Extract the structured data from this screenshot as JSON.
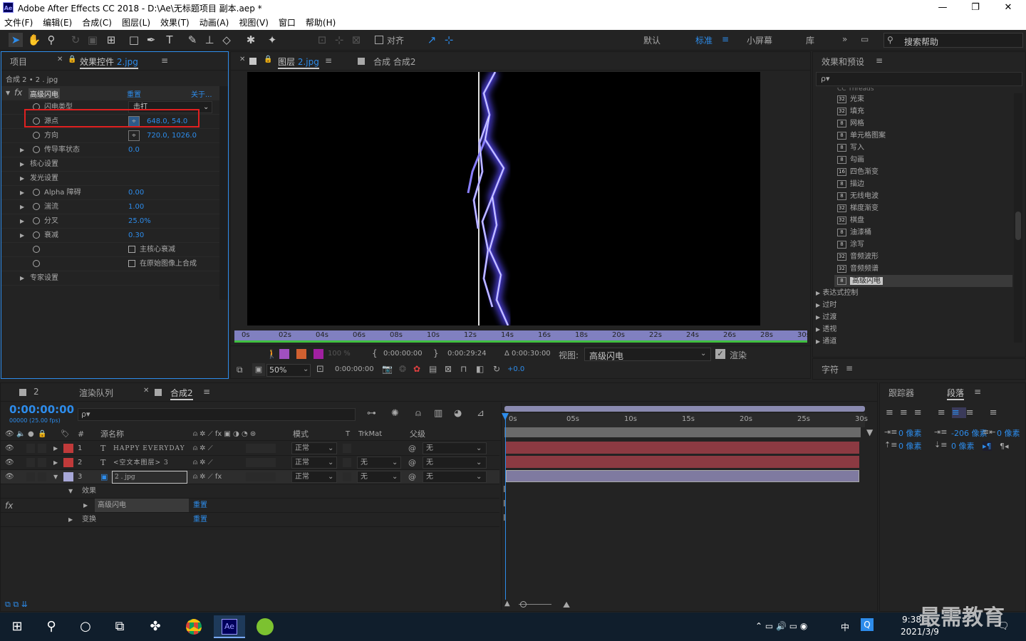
{
  "title_bar": {
    "app_icon": "Ae",
    "title": "Adobe After Effects CC 2018 - D:\\Ae\\无标题项目 副本.aep *",
    "minimize": "—",
    "maximize": "❐",
    "close": "✕"
  },
  "menu": [
    "文件(F)",
    "编辑(E)",
    "合成(C)",
    "图层(L)",
    "效果(T)",
    "动画(A)",
    "视图(V)",
    "窗口",
    "帮助(H)"
  ],
  "toolbar": {
    "snap_label": "对齐",
    "workspaces": [
      "默认",
      "标准",
      "小屏幕",
      "库"
    ],
    "active_workspace": "标准",
    "search_help_placeholder": "搜索帮助"
  },
  "left_panel": {
    "tab_project": "项目",
    "tab_effect_controls": "效果控件",
    "tab_effect_target": "2.jpg",
    "breadcrumb": "合成 2 • 2 . jpg",
    "effect_name": "高级闪电",
    "reset": "重置",
    "about": "关于...",
    "props": [
      {
        "name": "闪电类型",
        "value": "击打",
        "type": "dropdown"
      },
      {
        "name": "源点",
        "value": "648.0, 54.0",
        "type": "point"
      },
      {
        "name": "方向",
        "value": "720.0, 1026.0",
        "type": "point"
      },
      {
        "name": "传导率状态",
        "value": "0.0",
        "type": "num"
      },
      {
        "name": "核心设置",
        "value": "",
        "type": "group"
      },
      {
        "name": "发光设置",
        "value": "",
        "type": "group"
      },
      {
        "name": "Alpha 障碍",
        "value": "0.00",
        "type": "num"
      },
      {
        "name": "湍流",
        "value": "1.00",
        "type": "num"
      },
      {
        "name": "分叉",
        "value": "25.0%",
        "type": "num"
      },
      {
        "name": "衰减",
        "value": "0.30",
        "type": "num"
      },
      {
        "name": "",
        "value": "主核心衰减",
        "type": "check"
      },
      {
        "name": "",
        "value": "在原始图像上合成",
        "type": "check"
      },
      {
        "name": "专家设置",
        "value": "",
        "type": "group"
      }
    ]
  },
  "viewer": {
    "tab_layer": "图层",
    "tab_layer_target": "2.jpg",
    "tab_comp": "合成 合成2",
    "ruler": [
      "0s",
      "02s",
      "04s",
      "06s",
      "08s",
      "10s",
      "12s",
      "14s",
      "16s",
      "18s",
      "20s",
      "22s",
      "24s",
      "26s",
      "28s",
      "30s"
    ],
    "opacity": "100 %",
    "in_time": "0:00:00:00",
    "out_time": "0:00:29:24",
    "duration": "Δ 0:00:30:00",
    "view_label": "视图:",
    "view_value": "高级闪电",
    "render_label": "渲染",
    "zoom": "50%",
    "current_time": "0:00:00:00",
    "exposure": "+0.0"
  },
  "effects_presets": {
    "title": "效果和预设",
    "truncated_top": "CC Threads",
    "items": [
      "光束",
      "填充",
      "网格",
      "单元格图案",
      "写入",
      "勾画",
      "四色渐变",
      "描边",
      "无线电波",
      "梯度渐变",
      "棋盘",
      "油漆桶",
      "涂写",
      "音频波形",
      "音频频谱",
      "高级闪电"
    ],
    "badges": [
      "32",
      "32",
      "8",
      "8",
      "8",
      "8",
      "16",
      "8",
      "8",
      "32",
      "32",
      "8",
      "8",
      "32",
      "32",
      "8"
    ],
    "selected": "高级闪电",
    "categories": [
      "表达式控制",
      "过时",
      "过渡",
      "透视",
      "通道"
    ],
    "character_title": "字符"
  },
  "paragraph": {
    "tab_tracker": "跟踪器",
    "tab_paragraph": "段落",
    "indent_left": "0 像素",
    "indent_first": "-206 像素",
    "indent_right": "0 像素",
    "space_before": "0 像素",
    "space_after": "0 像素"
  },
  "timeline": {
    "tab_2": "2",
    "tab_render": "渲染队列",
    "tab_comp": "合成2",
    "timecode": "0:00:00:00",
    "fps": "00000 (25.00 fps)",
    "search_placeholder": "ρ▾",
    "headers": {
      "num": "#",
      "name": "源名称",
      "mode": "模式",
      "t": "T",
      "trkmat": "TrkMat",
      "parent": "父级"
    },
    "layers": [
      {
        "num": "1",
        "type": "T",
        "name": "HAPPY EVERYDAY",
        "mode": "正常",
        "trkmat": "",
        "parent": "无",
        "color": "#c03a3a"
      },
      {
        "num": "2",
        "type": "T",
        "name": "<空文本图层> 3",
        "mode": "正常",
        "trkmat": "无",
        "parent": "无",
        "color": "#c03a3a"
      },
      {
        "num": "3",
        "type": "img",
        "name": "2 . jpg",
        "mode": "正常",
        "trkmat": "无",
        "parent": "无",
        "color": "#a8a8d8"
      }
    ],
    "effects_label": "效果",
    "effect_item": "高级闪电",
    "reset": "重置",
    "transform_label": "变换",
    "ruler": [
      "0s",
      "05s",
      "10s",
      "15s",
      "20s",
      "25s",
      "30s"
    ]
  },
  "taskbar": {
    "time": "9:38",
    "date": "2021/3/9",
    "ime": "中",
    "watermark": "最需教育"
  }
}
